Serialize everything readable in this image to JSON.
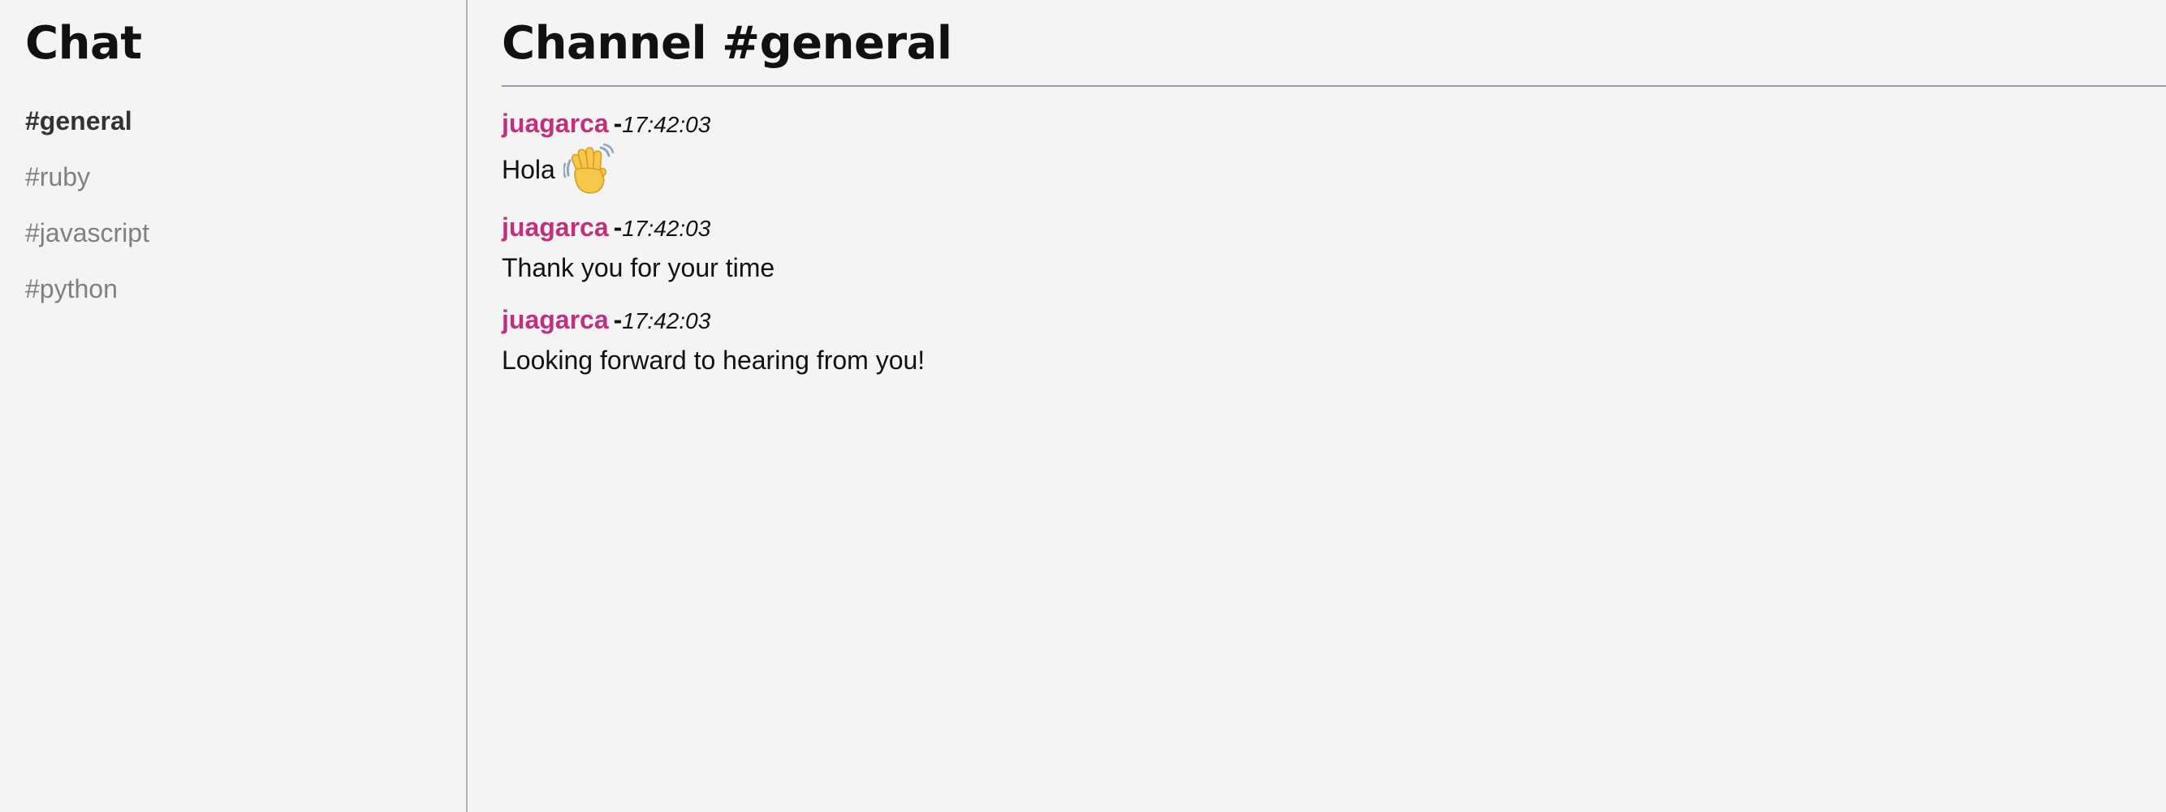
{
  "sidebar": {
    "title": "Chat",
    "channels": [
      {
        "label": "#general",
        "active": true
      },
      {
        "label": "#ruby",
        "active": false
      },
      {
        "label": "#javascript",
        "active": false
      },
      {
        "label": "#python",
        "active": false
      }
    ]
  },
  "main": {
    "header": "Channel #general",
    "messages": [
      {
        "author": "juagarca",
        "separator": "-",
        "time": "17:42:03",
        "text": "Hola",
        "emoji_icon": "waving-hand-icon"
      },
      {
        "author": "juagarca",
        "separator": "-",
        "time": "17:42:03",
        "text": "Thank you for your time"
      },
      {
        "author": "juagarca",
        "separator": "-",
        "time": "17:42:03",
        "text": "Looking forward to hearing from you!"
      }
    ]
  },
  "colors": {
    "background": "#f4f4f4",
    "author": "#c0307e",
    "active_channel": "#333333",
    "inactive_channel": "#808080",
    "divider": "#b3b3b3"
  }
}
